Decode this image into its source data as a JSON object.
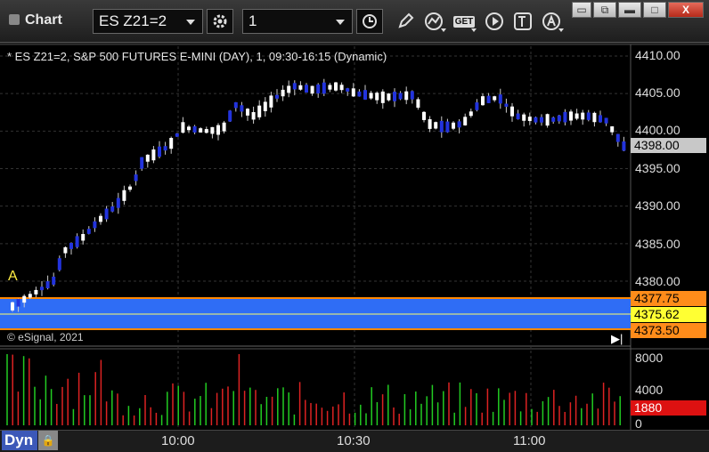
{
  "window": {
    "title": "Chart",
    "symbol": "ES Z21=2",
    "interval": "1",
    "buttons": {
      "minimize": "▭",
      "restore": "⧉",
      "maximize": "□",
      "close": "X"
    }
  },
  "toolbar": {
    "get_label": "GET",
    "icons": [
      "gear-icon",
      "clock-icon",
      "pencil-icon",
      "study-icon",
      "get-icon",
      "play-icon",
      "text-icon",
      "alert-icon"
    ]
  },
  "chart": {
    "symbol_info": "* ES Z21=2, S&P 500 FUTURES E-MINI (DAY), 1, 09:30-16:15 (Dynamic)",
    "copyright": "© eSignal, 2021",
    "marker_a": "A",
    "price_axis": [
      "4410.00",
      "4405.00",
      "4400.00",
      "4395.00",
      "4390.00",
      "4385.00",
      "4380.00"
    ],
    "tags": {
      "last": "4398.00",
      "upper": "4377.75",
      "mid": "4375.62",
      "lower": "4373.50",
      "volume": "1880"
    },
    "volume_axis": [
      "8000",
      "4000",
      "0"
    ],
    "time_axis": [
      "10:00",
      "10:30",
      "11:00"
    ],
    "colors": {
      "up": "#ffffff",
      "down": "#2233dd",
      "band": "#2f6df5",
      "band_edge": "#ff8800",
      "vol_up": "#22cc22",
      "vol_down": "#dd2222"
    }
  },
  "bottom": {
    "mode": "Dyn"
  }
}
